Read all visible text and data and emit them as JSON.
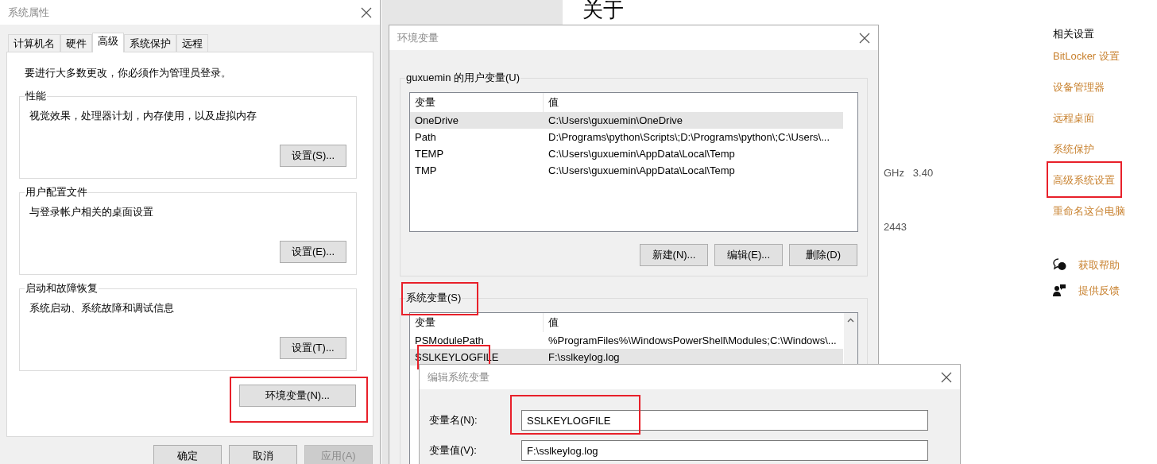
{
  "settings_page": {
    "heading": "关于",
    "spec_fragments": [
      "GHz   3.40",
      "2443"
    ],
    "related": {
      "title": "相关设置",
      "links": [
        {
          "label": "BitLocker 设置",
          "highlighted": false
        },
        {
          "label": "设备管理器",
          "highlighted": false
        },
        {
          "label": "远程桌面",
          "highlighted": false
        },
        {
          "label": "系统保护",
          "highlighted": false
        },
        {
          "label": "高级系统设置",
          "highlighted": true
        },
        {
          "label": "重命名这台电脑",
          "highlighted": false
        }
      ]
    },
    "support": [
      {
        "kind": "help",
        "label": "获取帮助"
      },
      {
        "kind": "feedback",
        "label": "提供反馈"
      }
    ]
  },
  "system_properties": {
    "title": "系统属性",
    "tabs": [
      {
        "label": "计算机名",
        "selected": false
      },
      {
        "label": "硬件",
        "selected": false
      },
      {
        "label": "高级",
        "selected": true
      },
      {
        "label": "系统保护",
        "selected": false
      },
      {
        "label": "远程",
        "selected": false
      }
    ],
    "notice": "要进行大多数更改，你必须作为管理员登录。",
    "groups": [
      {
        "title": "性能",
        "description": "视觉效果，处理器计划，内存使用，以及虚拟内存",
        "button": "设置(S)..."
      },
      {
        "title": "用户配置文件",
        "description": "与登录帐户相关的桌面设置",
        "button": "设置(E)..."
      },
      {
        "title": "启动和故障恢复",
        "description": "系统启动、系统故障和调试信息",
        "button": "设置(T)..."
      }
    ],
    "env_button": {
      "label": "环境变量(N)...",
      "highlighted": true
    },
    "buttons": [
      {
        "label": "确定",
        "disabled": false
      },
      {
        "label": "取消",
        "disabled": false
      },
      {
        "label": "应用(A)",
        "disabled": true
      }
    ]
  },
  "env_vars": {
    "title": "环境变量",
    "user_group": {
      "title": "guxuemin 的用户变量(U)",
      "columns": [
        "变量",
        "值"
      ],
      "rows": [
        {
          "name": "OneDrive",
          "value": "C:\\Users\\guxuemin\\OneDrive",
          "selected": true,
          "highlighted": false
        },
        {
          "name": "Path",
          "value": "D:\\Programs\\python\\Scripts\\;D:\\Programs\\python\\;C:\\Users\\...",
          "selected": false,
          "highlighted": false
        },
        {
          "name": "TEMP",
          "value": "C:\\Users\\guxuemin\\AppData\\Local\\Temp",
          "selected": false,
          "highlighted": false
        },
        {
          "name": "TMP",
          "value": "C:\\Users\\guxuemin\\AppData\\Local\\Temp",
          "selected": false,
          "highlighted": false
        }
      ],
      "buttons": [
        "新建(N)...",
        "编辑(E)...",
        "删除(D)"
      ]
    },
    "system_group": {
      "title": "系统变量(S)",
      "highlighted": true,
      "columns": [
        "变量",
        "值"
      ],
      "rows": [
        {
          "name": "PSModulePath",
          "value": "%ProgramFiles%\\WindowsPowerShell\\Modules;C:\\Windows\\...",
          "selected": false,
          "highlighted": false
        },
        {
          "name": "SSLKEYLOGFILE",
          "value": "F:\\sslkeylog.log",
          "selected": true,
          "highlighted": true
        }
      ]
    }
  },
  "edit_dialog": {
    "title": "编辑系统变量",
    "fields": [
      {
        "label": "变量名(N):",
        "value": "SSLKEYLOGFILE",
        "highlighted": true
      },
      {
        "label": "变量值(V):",
        "value": "F:\\sslkeylog.log",
        "highlighted": false
      }
    ]
  }
}
